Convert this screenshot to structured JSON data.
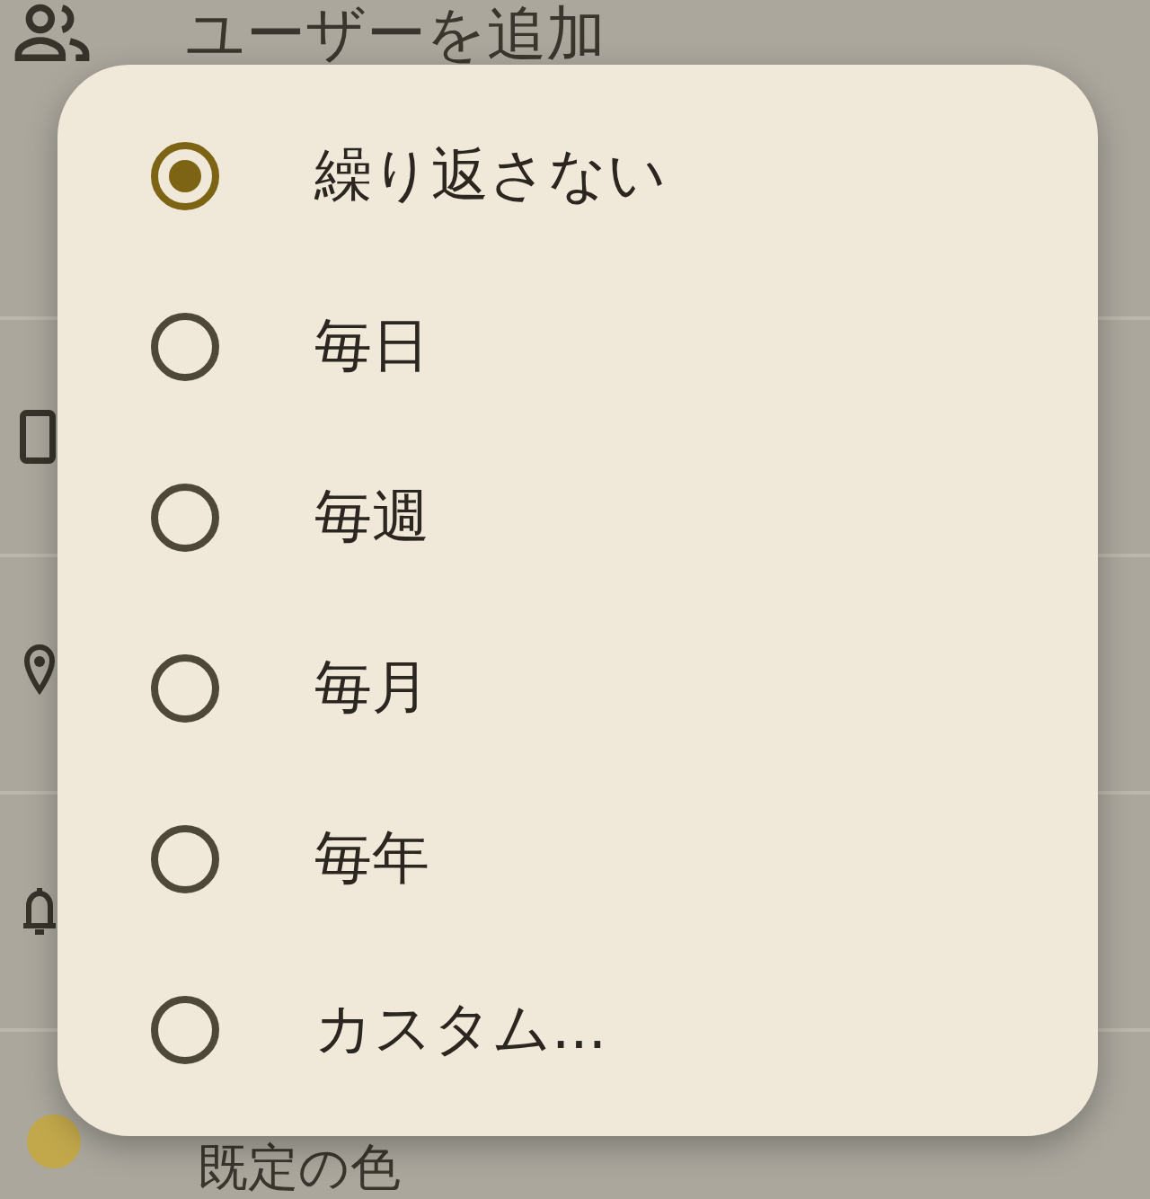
{
  "background_screen": {
    "rows": [
      {
        "kind": "guests",
        "label": "ユーザーを追加"
      },
      {
        "kind": "video"
      },
      {
        "kind": "location"
      },
      {
        "kind": "notification"
      },
      {
        "kind": "color",
        "label": "既定の色"
      }
    ]
  },
  "repeat_dialog": {
    "options": [
      {
        "label": "繰り返さない",
        "selected": true
      },
      {
        "label": "毎日",
        "selected": false
      },
      {
        "label": "毎週",
        "selected": false
      },
      {
        "label": "毎月",
        "selected": false
      },
      {
        "label": "毎年",
        "selected": false
      },
      {
        "label": "カスタム...",
        "selected": false
      }
    ]
  }
}
